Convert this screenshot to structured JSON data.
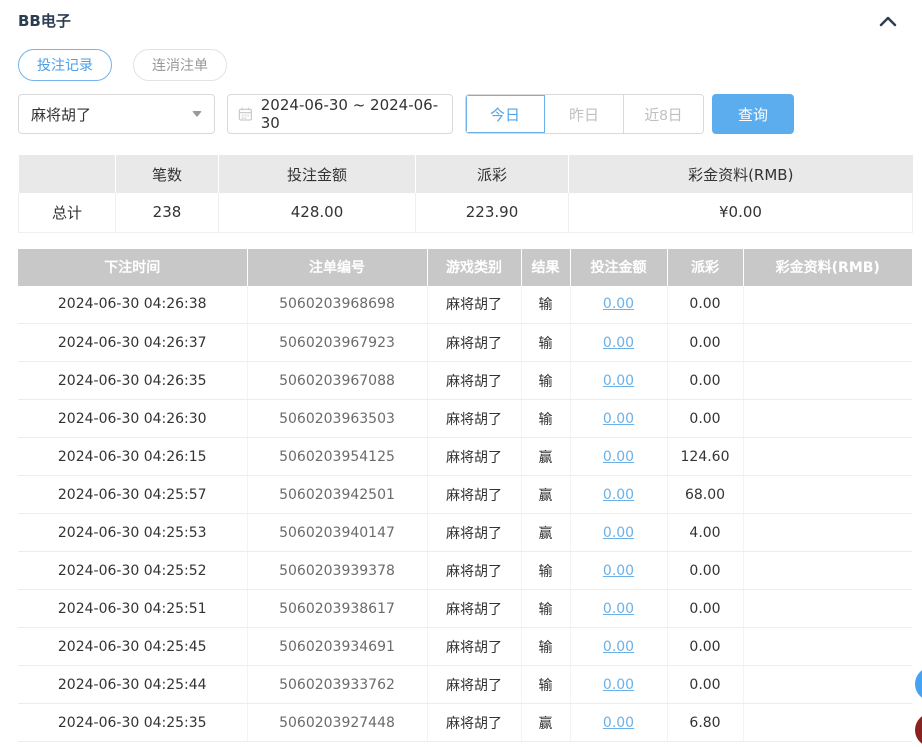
{
  "page": {
    "title": "BB电子"
  },
  "header": {
    "collapse_icon": "chevron-up"
  },
  "tabs": [
    {
      "label": "投注记录",
      "active": true
    },
    {
      "label": "连消注单",
      "active": false
    }
  ],
  "filters": {
    "game_select": {
      "value": "麻将胡了"
    },
    "date_range": {
      "value": "2024-06-30 ~ 2024-06-30",
      "icon": "calendar-icon"
    },
    "quick_ranges": [
      {
        "label": "今日",
        "active": true
      },
      {
        "label": "昨日",
        "active": false
      },
      {
        "label": "近8日",
        "active": false
      }
    ],
    "query_label": "查询"
  },
  "summary": {
    "headers": [
      "",
      "笔数",
      "投注金额",
      "派彩",
      "彩金资料(RMB)"
    ],
    "total": {
      "label": "总计",
      "count": "238",
      "bet_amount": "428.00",
      "payout": "223.90",
      "jackpot": "¥0.00"
    }
  },
  "records": {
    "headers": [
      "下注时间",
      "注单编号",
      "游戏类别",
      "结果",
      "投注金额",
      "派彩",
      "彩金资料(RMB)"
    ],
    "rows": [
      {
        "time": "2024-06-30 04:26:38",
        "order_id": "5060203968698",
        "game": "麻将胡了",
        "result": "输",
        "bet": "0.00",
        "payout": "0.00",
        "jackpot": ""
      },
      {
        "time": "2024-06-30 04:26:37",
        "order_id": "5060203967923",
        "game": "麻将胡了",
        "result": "输",
        "bet": "0.00",
        "payout": "0.00",
        "jackpot": ""
      },
      {
        "time": "2024-06-30 04:26:35",
        "order_id": "5060203967088",
        "game": "麻将胡了",
        "result": "输",
        "bet": "0.00",
        "payout": "0.00",
        "jackpot": ""
      },
      {
        "time": "2024-06-30 04:26:30",
        "order_id": "5060203963503",
        "game": "麻将胡了",
        "result": "输",
        "bet": "0.00",
        "payout": "0.00",
        "jackpot": ""
      },
      {
        "time": "2024-06-30 04:26:15",
        "order_id": "5060203954125",
        "game": "麻将胡了",
        "result": "赢",
        "bet": "0.00",
        "payout": "124.60",
        "jackpot": ""
      },
      {
        "time": "2024-06-30 04:25:57",
        "order_id": "5060203942501",
        "game": "麻将胡了",
        "result": "赢",
        "bet": "0.00",
        "payout": "68.00",
        "jackpot": ""
      },
      {
        "time": "2024-06-30 04:25:53",
        "order_id": "5060203940147",
        "game": "麻将胡了",
        "result": "赢",
        "bet": "0.00",
        "payout": "4.00",
        "jackpot": ""
      },
      {
        "time": "2024-06-30 04:25:52",
        "order_id": "5060203939378",
        "game": "麻将胡了",
        "result": "输",
        "bet": "0.00",
        "payout": "0.00",
        "jackpot": ""
      },
      {
        "time": "2024-06-30 04:25:51",
        "order_id": "5060203938617",
        "game": "麻将胡了",
        "result": "输",
        "bet": "0.00",
        "payout": "0.00",
        "jackpot": ""
      },
      {
        "time": "2024-06-30 04:25:45",
        "order_id": "5060203934691",
        "game": "麻将胡了",
        "result": "输",
        "bet": "0.00",
        "payout": "0.00",
        "jackpot": ""
      },
      {
        "time": "2024-06-30 04:25:44",
        "order_id": "5060203933762",
        "game": "麻将胡了",
        "result": "输",
        "bet": "0.00",
        "payout": "0.00",
        "jackpot": ""
      },
      {
        "time": "2024-06-30 04:25:35",
        "order_id": "5060203927448",
        "game": "麻将胡了",
        "result": "赢",
        "bet": "0.00",
        "payout": "6.80",
        "jackpot": ""
      }
    ]
  },
  "colors": {
    "accent_blue": "#5cadee",
    "link_blue": "#6cb2e8",
    "table_header_gray": "#c8c8c8",
    "summary_header_gray": "#e9e9e9",
    "title_navy": "#2c3d52",
    "float_blue": "#46a2f4",
    "float_red": "#8b2121"
  }
}
